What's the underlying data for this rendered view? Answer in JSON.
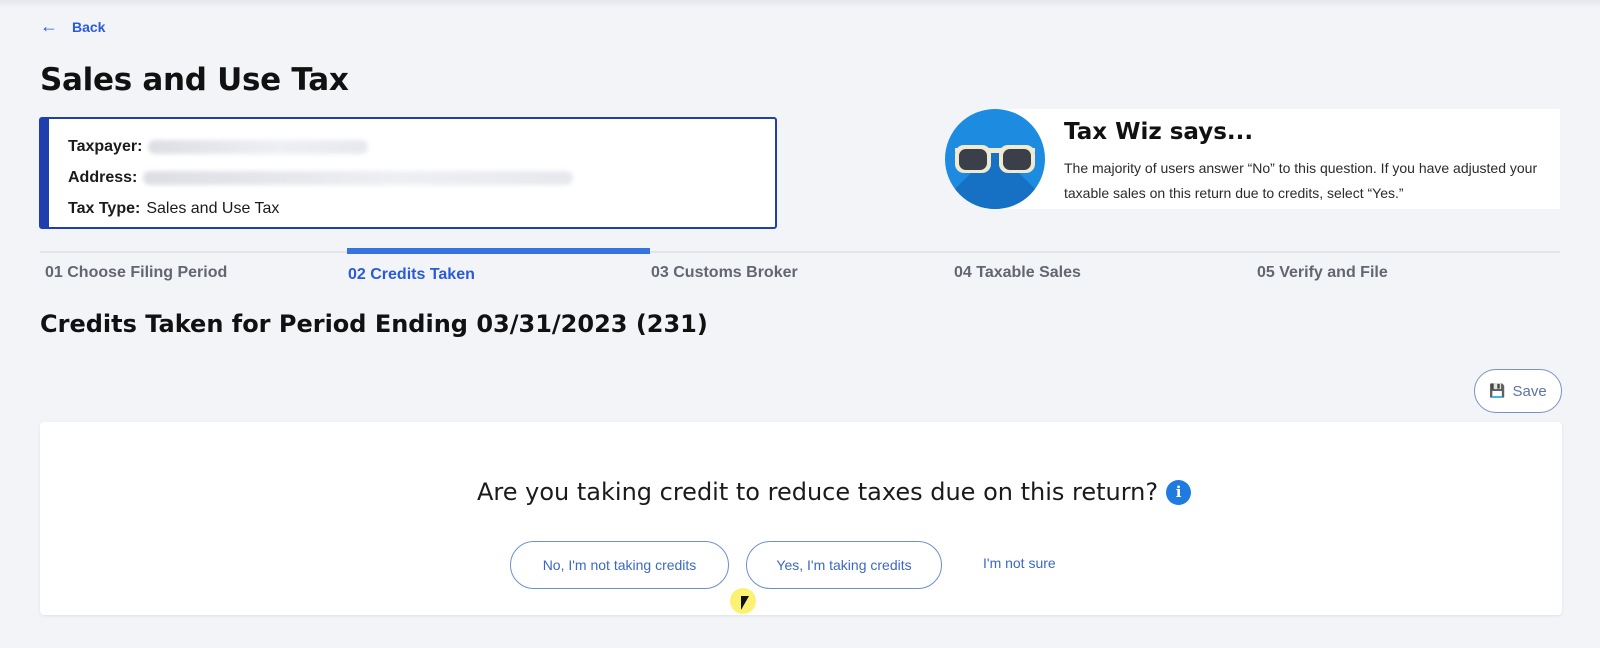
{
  "nav": {
    "back_label": "Back"
  },
  "page": {
    "title": "Sales and Use Tax"
  },
  "taxpayer": {
    "taxpayer_label": "Taxpayer:",
    "address_label": "Address:",
    "tax_type_label": "Tax Type:",
    "tax_type_value": "Sales and Use Tax"
  },
  "wiz": {
    "title": "Tax Wiz says...",
    "text": "The majority of users answer “No” to this question. If you have adjusted your taxable sales on this return due to credits, select “Yes.”"
  },
  "steps": [
    {
      "label": "01 Choose Filing Period"
    },
    {
      "label": "02 Credits Taken"
    },
    {
      "label": "03 Customs Broker"
    },
    {
      "label": "04 Taxable Sales"
    },
    {
      "label": "05 Verify and File"
    }
  ],
  "section": {
    "title": "Credits Taken for Period Ending 03/31/2023 (231)"
  },
  "actions": {
    "save_label": "Save"
  },
  "question": {
    "text": "Are you taking credit to reduce taxes due on this return?",
    "info_icon": "i",
    "options": {
      "no": "No, I'm not taking credits",
      "yes": "Yes, I'm taking credits",
      "unsure": "I'm not sure"
    }
  },
  "colors": {
    "accent": "#2a5bd7",
    "card_border": "#1f3fae",
    "avatar": "#1c8be0"
  }
}
